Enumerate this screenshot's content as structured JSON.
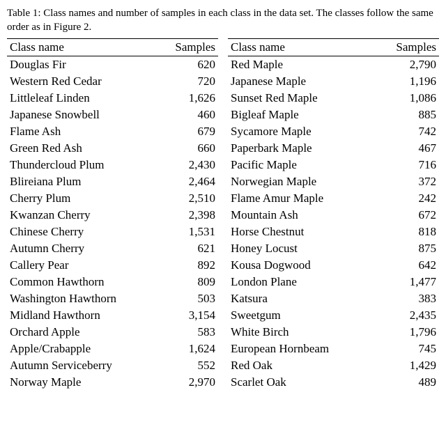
{
  "caption": "Table 1: Class names and number of samples in each class in the data set. The classes follow the same order as in Figure 2.",
  "headers": {
    "name": "Class name",
    "samples": "Samples"
  },
  "left": [
    {
      "name": "Douglas Fir",
      "samples": "620"
    },
    {
      "name": "Western Red Cedar",
      "samples": "720"
    },
    {
      "name": "Littleleaf Linden",
      "samples": "1,626"
    },
    {
      "name": "Japanese Snowbell",
      "samples": "460"
    },
    {
      "name": "Flame Ash",
      "samples": "679"
    },
    {
      "name": "Green Red Ash",
      "samples": "660"
    },
    {
      "name": "Thundercloud Plum",
      "samples": "2,430"
    },
    {
      "name": "Blireiana Plum",
      "samples": "2,464"
    },
    {
      "name": "Cherry Plum",
      "samples": "2,510"
    },
    {
      "name": "Kwanzan Cherry",
      "samples": "2,398"
    },
    {
      "name": "Chinese Cherry",
      "samples": "1,531"
    },
    {
      "name": "Autumn Cherry",
      "samples": "621"
    },
    {
      "name": "Callery Pear",
      "samples": "892"
    },
    {
      "name": "Common Hawthorn",
      "samples": "809"
    },
    {
      "name": "Washington Hawthorn",
      "samples": "503"
    },
    {
      "name": "Midland Hawthorn",
      "samples": "3,154"
    },
    {
      "name": "Orchard Apple",
      "samples": "583"
    },
    {
      "name": "Apple/Crabapple",
      "samples": "1,624"
    },
    {
      "name": "Autumn Serviceberry",
      "samples": "552"
    },
    {
      "name": "Norway Maple",
      "samples": "2,970"
    }
  ],
  "right": [
    {
      "name": "Red Maple",
      "samples": "2,790"
    },
    {
      "name": "Japanese Maple",
      "samples": "1,196"
    },
    {
      "name": "Sunset Red Maple",
      "samples": "1,086"
    },
    {
      "name": "Bigleaf Maple",
      "samples": "885"
    },
    {
      "name": "Sycamore Maple",
      "samples": "742"
    },
    {
      "name": "Paperbark Maple",
      "samples": "467"
    },
    {
      "name": "Pacific Maple",
      "samples": "716"
    },
    {
      "name": "Norwegian Maple",
      "samples": "372"
    },
    {
      "name": "Flame Amur Maple",
      "samples": "242"
    },
    {
      "name": "Mountain Ash",
      "samples": "672"
    },
    {
      "name": "Horse Chestnut",
      "samples": "818"
    },
    {
      "name": "Honey Locust",
      "samples": "875"
    },
    {
      "name": "Kousa Dogwood",
      "samples": "642"
    },
    {
      "name": "London Plane",
      "samples": "1,477"
    },
    {
      "name": "Katsura",
      "samples": "383"
    },
    {
      "name": "Sweetgum",
      "samples": "2,435"
    },
    {
      "name": "White Birch",
      "samples": "1,796"
    },
    {
      "name": "European Hornbeam",
      "samples": "745"
    },
    {
      "name": "Red Oak",
      "samples": "1,429"
    },
    {
      "name": "Scarlet Oak",
      "samples": "489"
    }
  ],
  "chart_data": {
    "type": "table",
    "title": "Table 1: Class names and number of samples in each class in the data set. The classes follow the same order as in Figure 2.",
    "columns": [
      "Class name",
      "Samples"
    ],
    "rows": [
      [
        "Douglas Fir",
        620
      ],
      [
        "Western Red Cedar",
        720
      ],
      [
        "Littleleaf Linden",
        1626
      ],
      [
        "Japanese Snowbell",
        460
      ],
      [
        "Flame Ash",
        679
      ],
      [
        "Green Red Ash",
        660
      ],
      [
        "Thundercloud Plum",
        2430
      ],
      [
        "Blireiana Plum",
        2464
      ],
      [
        "Cherry Plum",
        2510
      ],
      [
        "Kwanzan Cherry",
        2398
      ],
      [
        "Chinese Cherry",
        1531
      ],
      [
        "Autumn Cherry",
        621
      ],
      [
        "Callery Pear",
        892
      ],
      [
        "Common Hawthorn",
        809
      ],
      [
        "Washington Hawthorn",
        503
      ],
      [
        "Midland Hawthorn",
        3154
      ],
      [
        "Orchard Apple",
        583
      ],
      [
        "Apple/Crabapple",
        1624
      ],
      [
        "Autumn Serviceberry",
        552
      ],
      [
        "Norway Maple",
        2970
      ],
      [
        "Red Maple",
        2790
      ],
      [
        "Japanese Maple",
        1196
      ],
      [
        "Sunset Red Maple",
        1086
      ],
      [
        "Bigleaf Maple",
        885
      ],
      [
        "Sycamore Maple",
        742
      ],
      [
        "Paperbark Maple",
        467
      ],
      [
        "Pacific Maple",
        716
      ],
      [
        "Norwegian Maple",
        372
      ],
      [
        "Flame Amur Maple",
        242
      ],
      [
        "Mountain Ash",
        672
      ],
      [
        "Horse Chestnut",
        818
      ],
      [
        "Honey Locust",
        875
      ],
      [
        "Kousa Dogwood",
        642
      ],
      [
        "London Plane",
        1477
      ],
      [
        "Katsura",
        383
      ],
      [
        "Sweetgum",
        2435
      ],
      [
        "White Birch",
        1796
      ],
      [
        "European Hornbeam",
        745
      ],
      [
        "Red Oak",
        1429
      ],
      [
        "Scarlet Oak",
        489
      ]
    ]
  }
}
